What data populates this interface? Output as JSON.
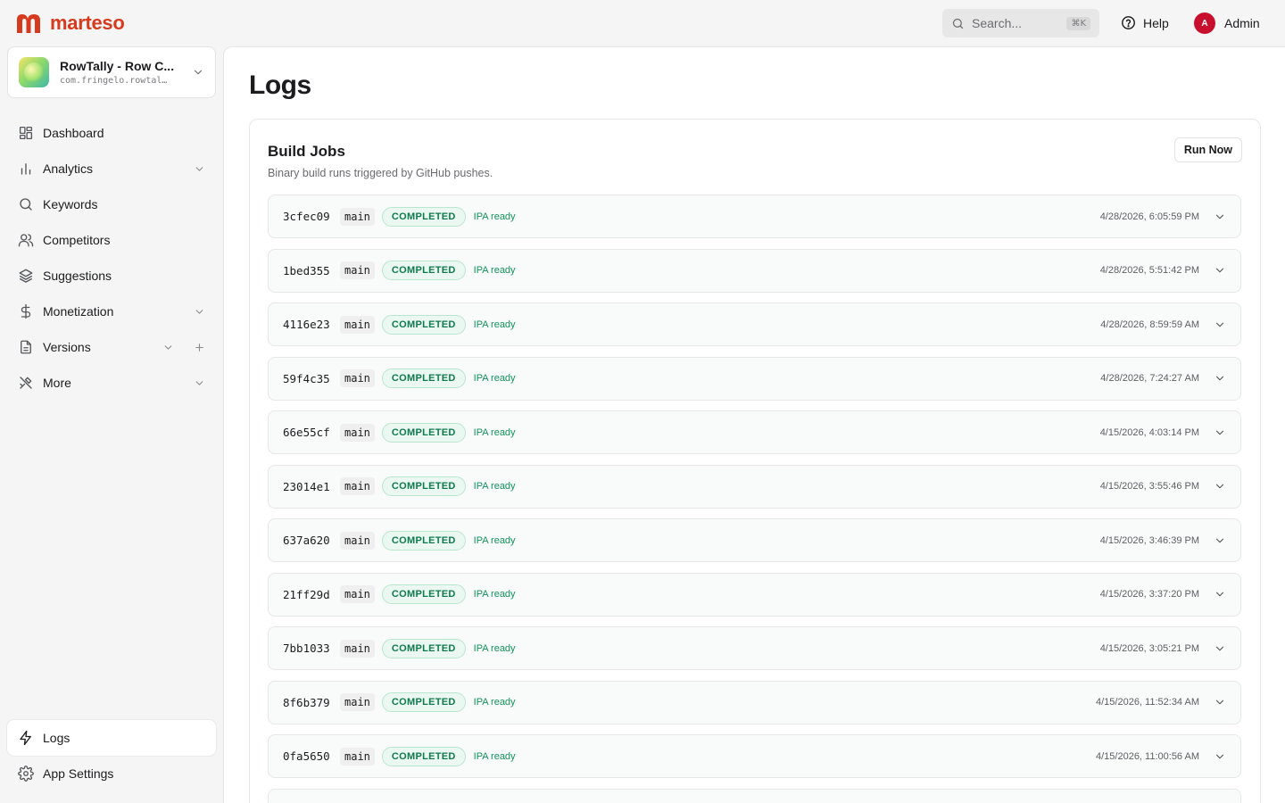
{
  "brand": {
    "name": "marteso",
    "color": "#d63b1f"
  },
  "search": {
    "placeholder": "Search...",
    "shortcut": "⌘K"
  },
  "header": {
    "help_label": "Help",
    "user_initial": "A",
    "user_name": "Admin",
    "avatar_color": "#c8102e"
  },
  "app": {
    "name": "RowTally - Row C...",
    "bundle": "com.fringelo.rowtal…"
  },
  "sidebar": {
    "items": [
      {
        "label": "Dashboard",
        "icon": "dashboard-icon"
      },
      {
        "label": "Analytics",
        "icon": "bar-chart-icon",
        "expandable": true
      },
      {
        "label": "Keywords",
        "icon": "search-icon"
      },
      {
        "label": "Competitors",
        "icon": "users-icon"
      },
      {
        "label": "Suggestions",
        "icon": "layers-icon"
      },
      {
        "label": "Monetization",
        "icon": "dollar-icon",
        "expandable": true
      },
      {
        "label": "Versions",
        "icon": "document-icon",
        "expandable": true,
        "addable": true
      },
      {
        "label": "More",
        "icon": "tools-icon",
        "expandable": true
      }
    ],
    "bottom": [
      {
        "label": "Logs",
        "icon": "zap-icon",
        "active": true
      },
      {
        "label": "App Settings",
        "icon": "gear-icon"
      }
    ]
  },
  "page": {
    "title": "Logs"
  },
  "card": {
    "title": "Build Jobs",
    "subtitle": "Binary build runs triggered by GitHub pushes.",
    "run_label": "Run Now"
  },
  "jobs": [
    {
      "sha": "3cfec09",
      "branch": "main",
      "status": "COMPLETED",
      "note": "IPA ready",
      "time": "4/28/2026, 6:05:59 PM"
    },
    {
      "sha": "1bed355",
      "branch": "main",
      "status": "COMPLETED",
      "note": "IPA ready",
      "time": "4/28/2026, 5:51:42 PM"
    },
    {
      "sha": "4116e23",
      "branch": "main",
      "status": "COMPLETED",
      "note": "IPA ready",
      "time": "4/28/2026, 8:59:59 AM"
    },
    {
      "sha": "59f4c35",
      "branch": "main",
      "status": "COMPLETED",
      "note": "IPA ready",
      "time": "4/28/2026, 7:24:27 AM"
    },
    {
      "sha": "66e55cf",
      "branch": "main",
      "status": "COMPLETED",
      "note": "IPA ready",
      "time": "4/15/2026, 4:03:14 PM"
    },
    {
      "sha": "23014e1",
      "branch": "main",
      "status": "COMPLETED",
      "note": "IPA ready",
      "time": "4/15/2026, 3:55:46 PM"
    },
    {
      "sha": "637a620",
      "branch": "main",
      "status": "COMPLETED",
      "note": "IPA ready",
      "time": "4/15/2026, 3:46:39 PM"
    },
    {
      "sha": "21ff29d",
      "branch": "main",
      "status": "COMPLETED",
      "note": "IPA ready",
      "time": "4/15/2026, 3:37:20 PM"
    },
    {
      "sha": "7bb1033",
      "branch": "main",
      "status": "COMPLETED",
      "note": "IPA ready",
      "time": "4/15/2026, 3:05:21 PM"
    },
    {
      "sha": "8f6b379",
      "branch": "main",
      "status": "COMPLETED",
      "note": "IPA ready",
      "time": "4/15/2026, 11:52:34 AM"
    },
    {
      "sha": "0fa5650",
      "branch": "main",
      "status": "COMPLETED",
      "note": "IPA ready",
      "time": "4/15/2026, 11:00:56 AM"
    },
    {
      "sha": "",
      "branch": "",
      "status": "",
      "note": "",
      "time": ""
    }
  ]
}
